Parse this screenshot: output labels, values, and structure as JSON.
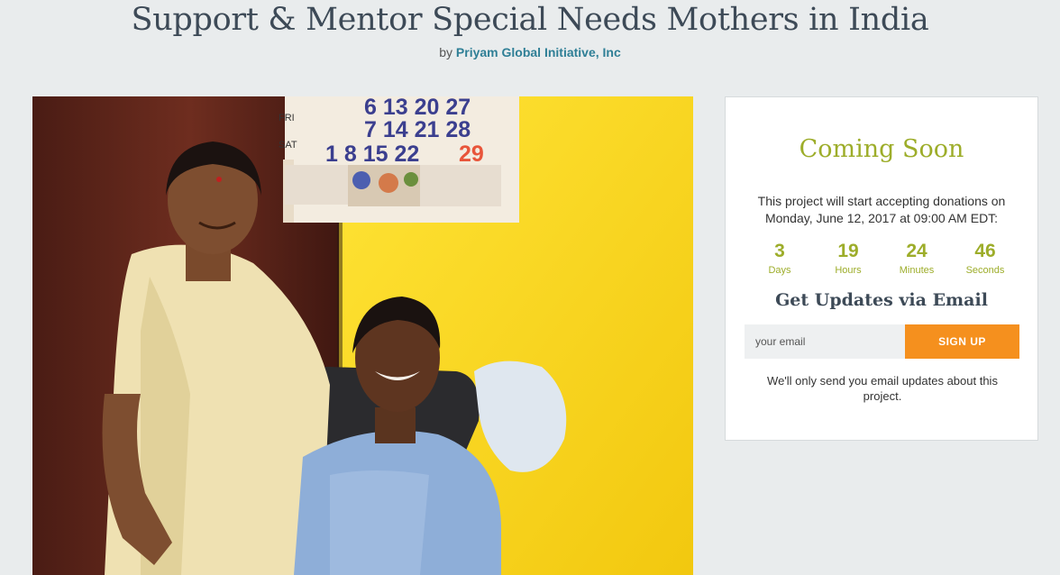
{
  "project": {
    "title": "Support & Mentor Special Needs Mothers in India",
    "by_prefix": "by",
    "organization": "Priyam Global Initiative, Inc"
  },
  "photo": {
    "calendar_row1": "6 13 20 27",
    "calendar_row2": "7 14 21 28",
    "calendar_row3_prefix": "1 8 15 22",
    "calendar_highlight": "29",
    "calendar_fri": "FRI",
    "calendar_sat": "SAT"
  },
  "panel": {
    "heading": "Coming Soon",
    "start_line1": "This project will start accepting donations on",
    "start_line2": "Monday, June 12, 2017 at 09:00 AM EDT:",
    "countdown": [
      {
        "value": "3",
        "unit": "Days"
      },
      {
        "value": "19",
        "unit": "Hours"
      },
      {
        "value": "24",
        "unit": "Minutes"
      },
      {
        "value": "46",
        "unit": "Seconds"
      }
    ],
    "updates_heading": "Get Updates via Email",
    "email_placeholder": "your email",
    "signup_label": "SIGN UP",
    "note": "We'll only send you email updates about this project."
  },
  "colors": {
    "accent_green": "#9dad2a",
    "signup_orange": "#f5901e",
    "link_teal": "#2f7f96",
    "background": "#e9eced"
  }
}
